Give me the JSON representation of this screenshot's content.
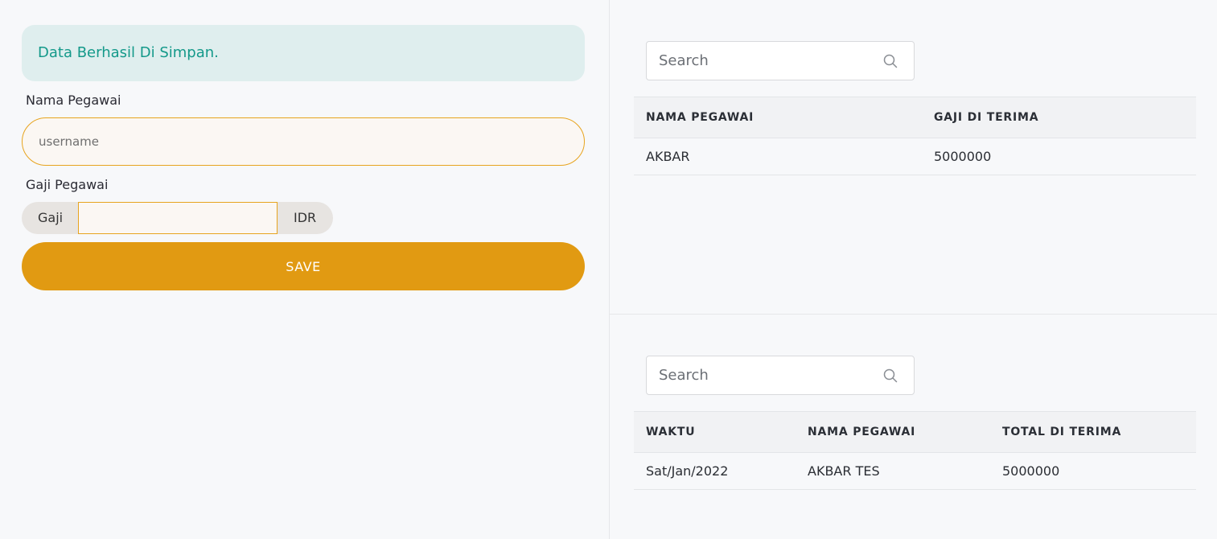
{
  "form": {
    "alert_message": "Data Berhasil Di Simpan.",
    "nama_label": "Nama Pegawai",
    "nama_placeholder": "username",
    "nama_value": "",
    "gaji_label": "Gaji Pegawai",
    "gaji_prefix": "Gaji",
    "gaji_value": "",
    "gaji_suffix": "IDR",
    "save_label": "SAVE"
  },
  "employees_table": {
    "search_placeholder": "Search",
    "headers": [
      "NAMA PEGAWAI",
      "GAJI DI TERIMA"
    ],
    "rows": [
      [
        "AKBAR",
        "5000000"
      ]
    ]
  },
  "payments_table": {
    "search_placeholder": "Search",
    "headers": [
      "WAKTU",
      "NAMA PEGAWAI",
      "TOTAL DI TERIMA"
    ],
    "rows": [
      [
        "Sat/Jan/2022",
        "AKBAR TES",
        "5000000"
      ]
    ]
  },
  "icons": {
    "search": "search-icon"
  },
  "colors": {
    "accent": "#e19a12",
    "alert_bg": "#dfeeee",
    "alert_text": "#14998a"
  }
}
